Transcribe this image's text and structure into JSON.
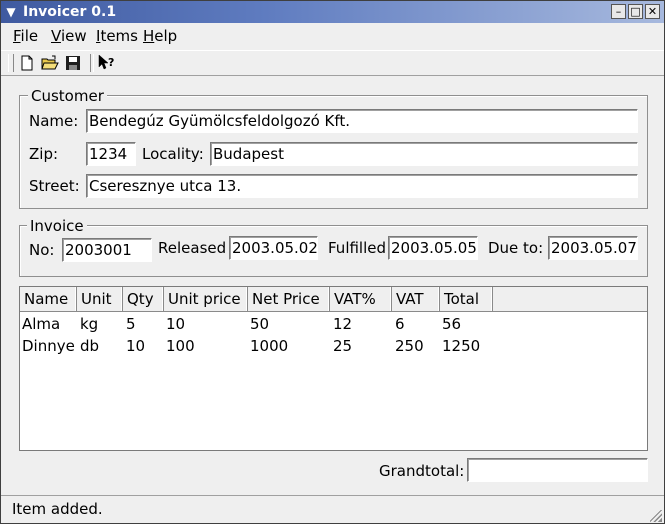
{
  "window": {
    "title": "Invoicer 0.1"
  },
  "menu": [
    "File",
    "View",
    "Items",
    "Help"
  ],
  "toolbar": {
    "icons": [
      "new-document-icon",
      "open-folder-icon",
      "save-disk-icon",
      "whats-this-help-icon"
    ]
  },
  "customer": {
    "group_title": "Customer",
    "name_label": "Name:",
    "name_value": "Bendegúz Gyümölcsfeldolgozó Kft.",
    "zip_label": "Zip:",
    "zip_value": "1234",
    "locality_label": "Locality:",
    "locality_value": "Budapest",
    "street_label": "Street:",
    "street_value": "Cseresznye utca 13."
  },
  "invoice": {
    "group_title": "Invoice",
    "no_label": "No:",
    "no_value": "2003001",
    "released_label": "Released",
    "released_value": "2003.05.02",
    "fulfilled_label": "Fulfilled",
    "fulfilled_value": "2003.05.05",
    "due_label": "Due to:",
    "due_value": "2003.05.07"
  },
  "items": {
    "columns": [
      "Name",
      "Unit",
      "Qty",
      "Unit price",
      "Net Price",
      "VAT%",
      "VAT",
      "Total"
    ],
    "rows": [
      [
        "Alma",
        "kg",
        "5",
        "10",
        "50",
        "12",
        "6",
        "56"
      ],
      [
        "Dinnye",
        "db",
        "10",
        "100",
        "1000",
        "25",
        "250",
        "1250"
      ]
    ]
  },
  "grandtotal": {
    "label": "Grandtotal:",
    "value": ""
  },
  "status": {
    "text": "Item added."
  }
}
